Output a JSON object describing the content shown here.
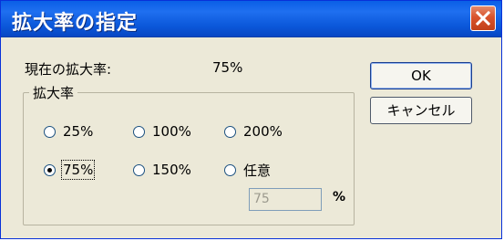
{
  "window": {
    "title": "拡大率の指定"
  },
  "current": {
    "label": "現在の拡大率:",
    "value": "75%"
  },
  "buttons": {
    "ok_label": "OK",
    "cancel_label": "キャンセル"
  },
  "group": {
    "label": "拡大率",
    "options": [
      {
        "label": "25%",
        "checked": false
      },
      {
        "label": "100%",
        "checked": false
      },
      {
        "label": "200%",
        "checked": false
      },
      {
        "label": "75%",
        "checked": true
      },
      {
        "label": "150%",
        "checked": false
      },
      {
        "label": "任意",
        "checked": false
      }
    ],
    "custom_value": "75",
    "custom_unit": "%"
  }
}
